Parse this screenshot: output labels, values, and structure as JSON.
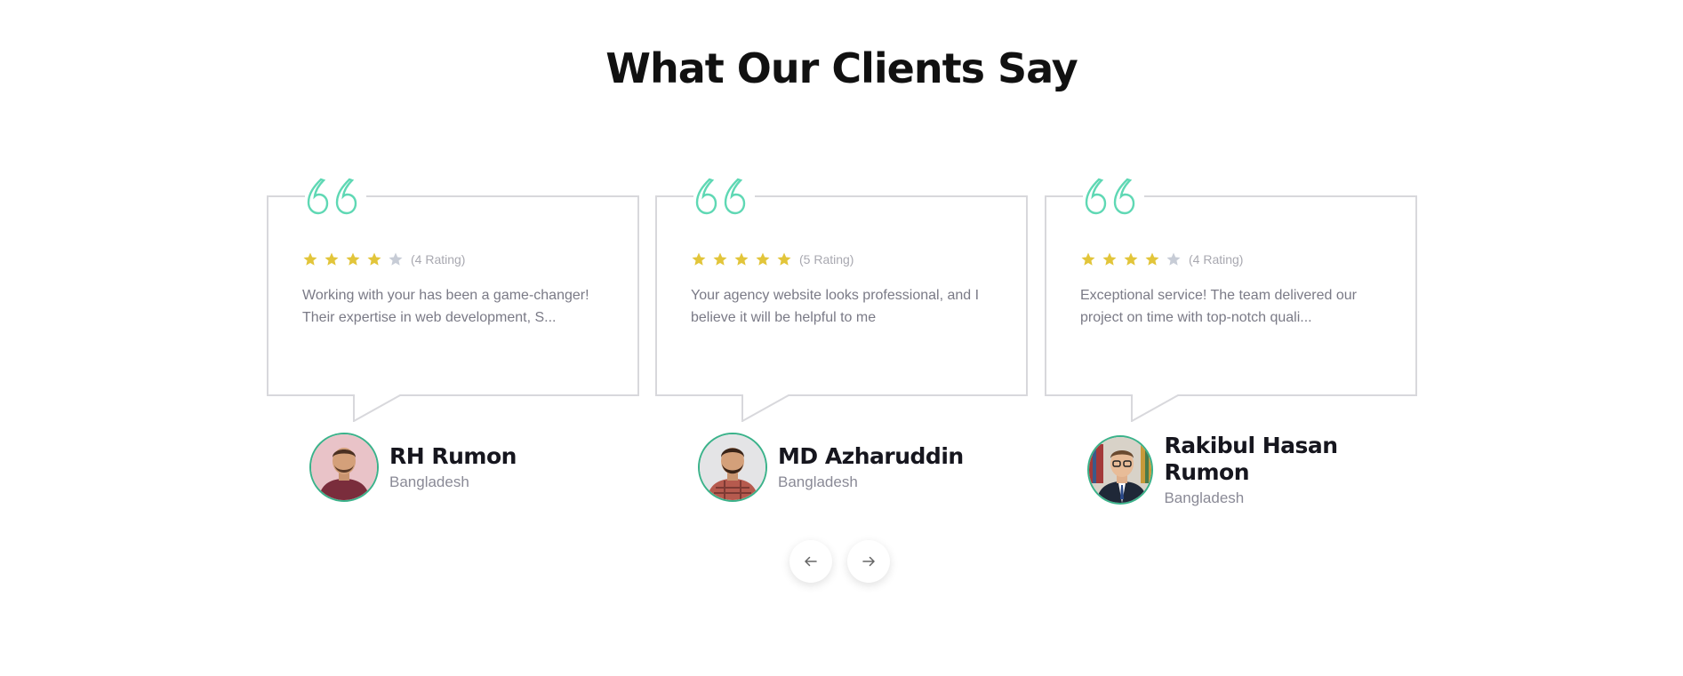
{
  "section": {
    "title": "What Our Clients Say"
  },
  "colors": {
    "accent": "#3ab28a",
    "quote": "#5fd8b4",
    "star_filled": "#e2c53a",
    "star_empty": "#c7ccd6",
    "border": "#d8d8dc"
  },
  "testimonials": [
    {
      "rating": 4,
      "rating_label": "(4 Rating)",
      "text": "Working with your has been a game-changer! Their expertise in web development, S...",
      "name": "RH Rumon",
      "country": "Bangladesh"
    },
    {
      "rating": 5,
      "rating_label": "(5 Rating)",
      "text": "Your agency website looks professional, and I believe it will be helpful to me",
      "name": "MD Azharuddin",
      "country": "Bangladesh"
    },
    {
      "rating": 4,
      "rating_label": "(4 Rating)",
      "text": "Exceptional service! The team delivered our project on time with top-notch quali...",
      "name": "Rakibul Hasan Rumon",
      "country": "Bangladesh"
    }
  ],
  "navigation": {
    "prev_icon": "arrow-left-icon",
    "next_icon": "arrow-right-icon"
  }
}
